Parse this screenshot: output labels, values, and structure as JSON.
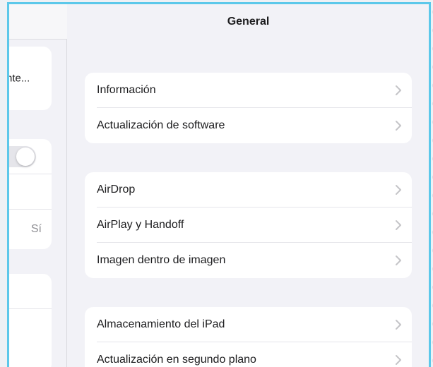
{
  "window": {
    "title": "General"
  },
  "sidebar": {
    "truncated_item": "nte...",
    "toggle_state": "off",
    "value_item": "Sí"
  },
  "groups": [
    {
      "items": [
        {
          "label": "Información",
          "icon": "chevron-right-icon"
        },
        {
          "label": "Actualización de software",
          "icon": "chevron-right-icon"
        }
      ]
    },
    {
      "items": [
        {
          "label": "AirDrop",
          "icon": "chevron-right-icon"
        },
        {
          "label": "AirPlay y Handoff",
          "icon": "chevron-right-icon"
        },
        {
          "label": "Imagen dentro de imagen",
          "icon": "chevron-right-icon"
        }
      ]
    },
    {
      "items": [
        {
          "label": "Almacenamiento del iPad",
          "icon": "chevron-right-icon"
        },
        {
          "label": "Actualización en segundo plano",
          "icon": "chevron-right-icon"
        }
      ]
    }
  ],
  "colors": {
    "frame_border": "#5cc8ea",
    "background": "#f2f2f7",
    "card": "#ffffff",
    "chevron": "#c4c4c7"
  }
}
